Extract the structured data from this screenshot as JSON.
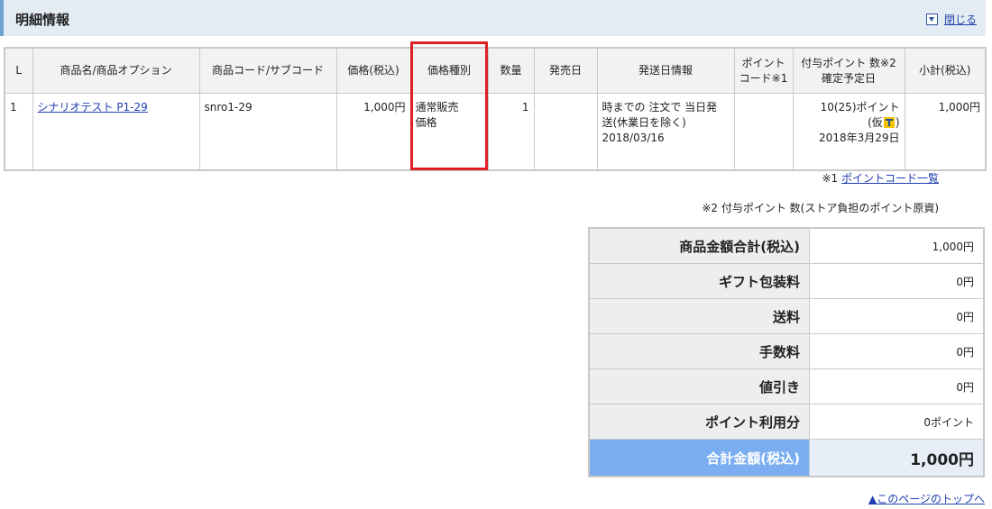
{
  "header": {
    "title": "明細情報",
    "close_label": "閉じる"
  },
  "table": {
    "columns": [
      "L",
      "商品名/商品オプション",
      "商品コード/サブコード",
      "価格(税込)",
      "価格種別",
      "数量",
      "発売日",
      "発送日情報",
      "ポイント\nコード※1",
      "付与ポイント 数※2\n確定予定日",
      "小計(税込)"
    ],
    "row": {
      "line": "1",
      "name": "シナリオテスト P1-29",
      "code": "snro1-29",
      "price": "1,000円",
      "price_type": "通常販売\n価格",
      "qty": "1",
      "release": "",
      "ship_info": "時までの 注文で 当日発\n送(休業日を除く)\n2018/03/16",
      "point_code": "",
      "points": "10(25)ポイント",
      "points_provisional_open": "(仮",
      "points_provisional_close": ")",
      "points_date": "2018年3月29日",
      "subtotal": "1,000円"
    }
  },
  "notes": {
    "note1_prefix": "※1 ",
    "note1_link": "ポイントコード一覧",
    "note2": "※2 付与ポイント 数(ストア負担のポイント原資)"
  },
  "summary": [
    {
      "label": "商品金額合計(税込)",
      "value": "1,000円"
    },
    {
      "label": "ギフト包装料",
      "value": "0円"
    },
    {
      "label": "送料",
      "value": "0円"
    },
    {
      "label": "手数料",
      "value": "0円"
    },
    {
      "label": "値引き",
      "value": "0円"
    },
    {
      "label": "ポイント利用分",
      "value": "0ポイント"
    }
  ],
  "total": {
    "label": "合計金額(税込)",
    "value": "1,000円"
  },
  "pagetop": "▲このページのトップへ",
  "icons": {
    "close": "dropdown-close-icon",
    "point": "t-point-icon"
  },
  "colors": {
    "highlight": "#dd1f26",
    "total_bg": "#7aaef1",
    "header_bg": "#e4ecf3"
  }
}
